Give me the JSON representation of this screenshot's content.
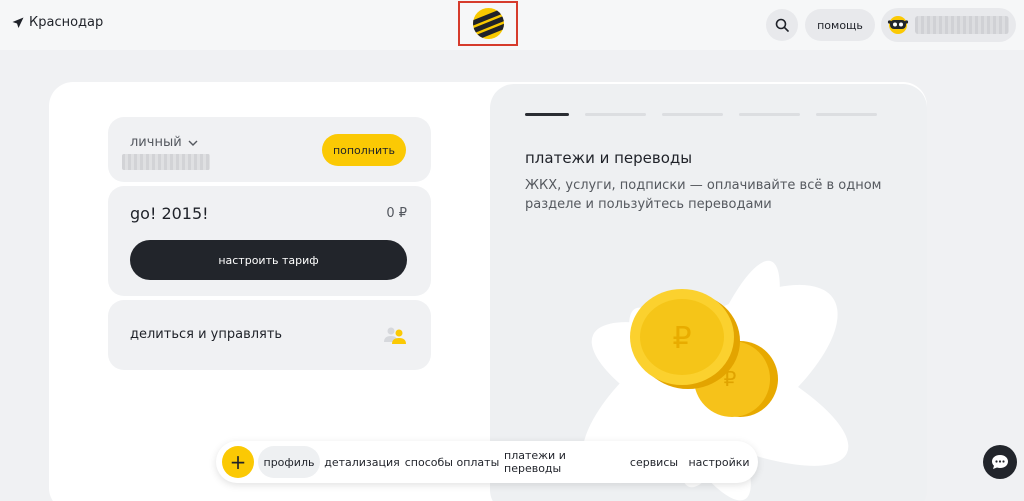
{
  "header": {
    "city": "Краснодар",
    "help_label": "помощь"
  },
  "account": {
    "type_label": "личный",
    "topup_label": "пополнить"
  },
  "tariff": {
    "name": "go! 2015!",
    "price": "0 ₽",
    "configure_label": "настроить тариф"
  },
  "share": {
    "label": "делиться и управлять"
  },
  "promo": {
    "title": "платежи и переводы",
    "text": "ЖКХ, услуги, подписки — оплачивайте всё в одном разделе и пользуйтесь переводами",
    "slide_count": 5,
    "active_slide": 1
  },
  "nav": {
    "plus": "+",
    "items": [
      {
        "label": "профиль",
        "active": true
      },
      {
        "label": "детализация",
        "active": false
      },
      {
        "label": "способы оплаты",
        "active": false
      },
      {
        "label": "платежи и переводы",
        "active": false
      },
      {
        "label": "сервисы",
        "active": false
      },
      {
        "label": "настройки",
        "active": false
      }
    ]
  },
  "colors": {
    "brand_yellow": "#fbc904",
    "dark": "#22252b",
    "background": "#f0f1f3",
    "highlight_border": "#d63b2c"
  },
  "icons": [
    "location-arrow-icon",
    "beeline-logo",
    "search-icon",
    "avatar-icon",
    "chevron-down-icon",
    "users-icon",
    "plus-icon",
    "chat-icon",
    "ruble-coins-illustration"
  ]
}
